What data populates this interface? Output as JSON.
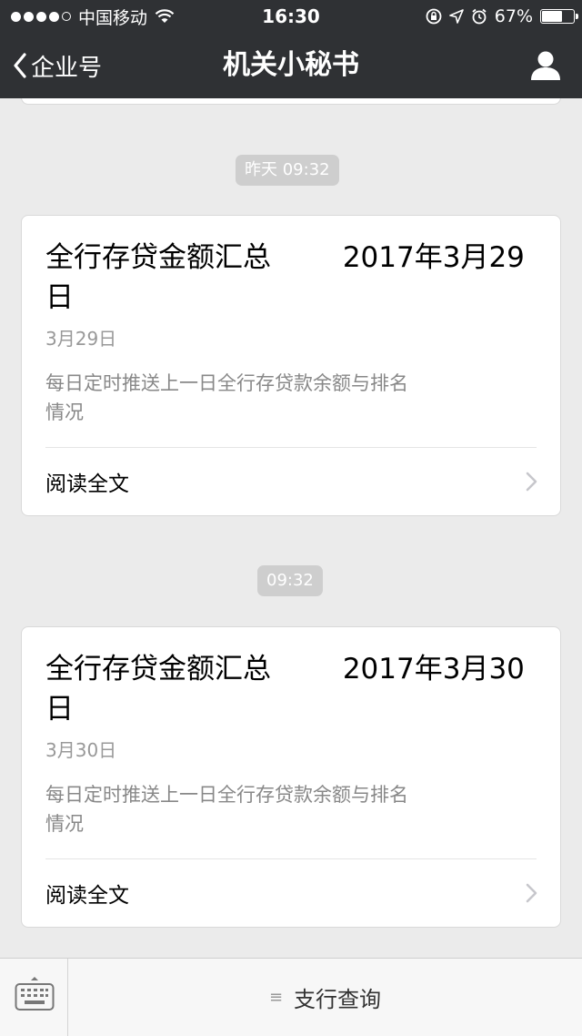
{
  "status_bar": {
    "carrier": "中国移动",
    "time": "16:30",
    "battery_text": "67%",
    "battery_level": 0.67,
    "icons": [
      "signal-dots",
      "wifi-icon",
      "orientation-lock-icon",
      "location-icon",
      "alarm-icon",
      "battery-icon"
    ]
  },
  "nav": {
    "back_label": "企业号",
    "title": "机关小秘书",
    "right_icon": "profile-icon"
  },
  "messages": [
    {
      "timestamp": "昨天 09:32",
      "title": "全行存贷金额汇总        2017年3月29日",
      "date": "3月29日",
      "summary": "每日定时推送上一日全行存贷款余额与排名情况",
      "read_more": "阅读全文"
    },
    {
      "timestamp": "09:32",
      "title": "全行存贷金额汇总        2017年3月30日",
      "date": "3月30日",
      "summary": "每日定时推送上一日全行存贷款余额与排名情况",
      "read_more": "阅读全文"
    }
  ],
  "bottom_bar": {
    "keyboard_icon": "keyboard-icon",
    "menu_icon": "menu-lines-icon",
    "menu_label": "支行查询"
  },
  "colors": {
    "bar_dark": "#2f3134",
    "background": "#ebebeb",
    "timestamp_pill": "#cecece",
    "muted_text": "#999999"
  }
}
